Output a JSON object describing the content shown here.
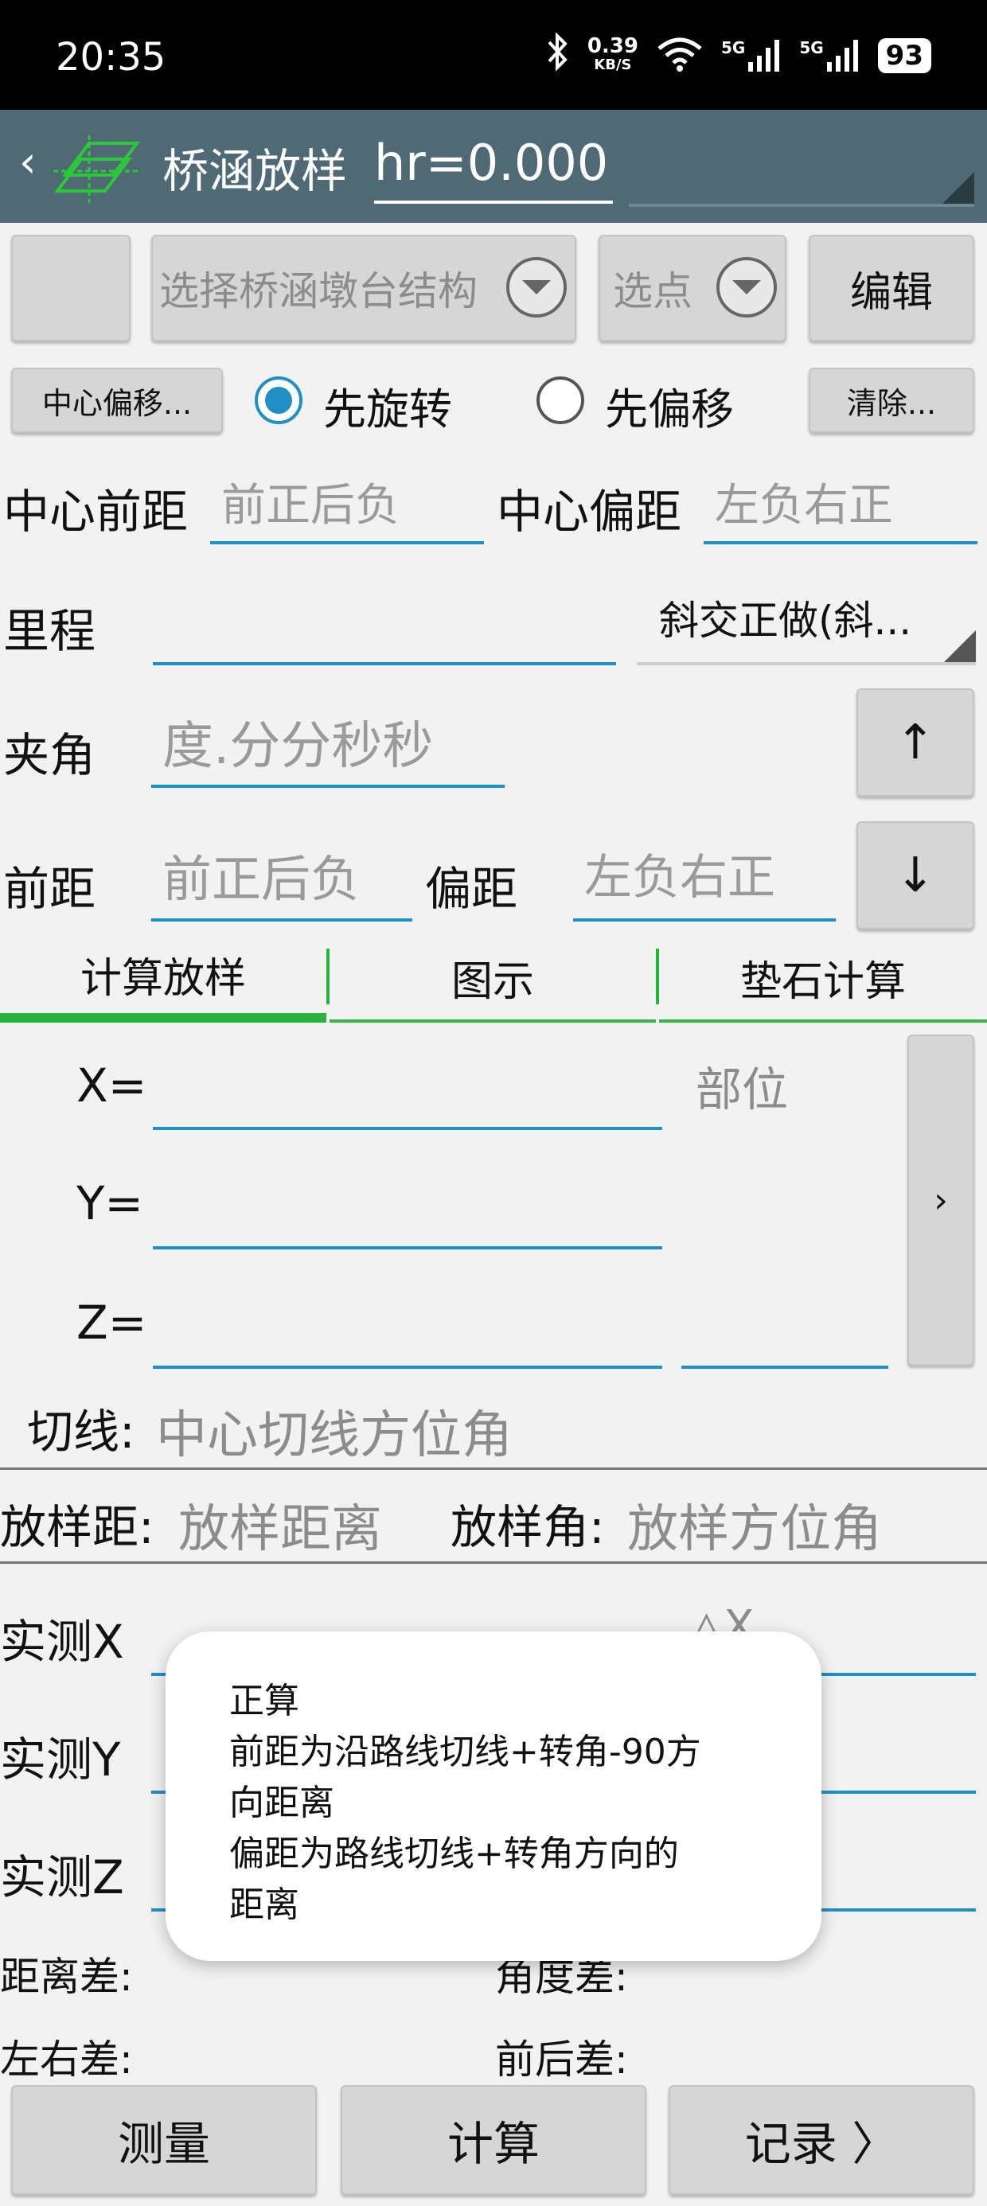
{
  "status": {
    "time": "20:35",
    "speed_value": "0.39",
    "speed_unit": "KB/S",
    "net1": "5G",
    "net2": "5G",
    "battery": "93"
  },
  "titlebar": {
    "title": "桥涵放样",
    "hr_value": "hr=0.000"
  },
  "toolbar": {
    "structure_placeholder": "选择桥涵墩台结构",
    "point_placeholder": "选点",
    "edit_label": "编辑",
    "center_offset_label": "中心偏移...",
    "rotate_first_label": "先旋转",
    "offset_first_label": "先偏移",
    "clear_label": "清除...",
    "rotate_first_selected": true
  },
  "form": {
    "center_front_label": "中心前距",
    "center_front_placeholder": "前正后负",
    "center_offset_label": "中心偏距",
    "center_offset_placeholder": "左负右正",
    "mileage_label": "里程",
    "mode_value": "斜交正做(斜...",
    "angle_label": "夹角",
    "angle_placeholder": "度.分分秒秒",
    "up_arrow": "↑",
    "down_arrow": "↓",
    "front_label": "前距",
    "front_placeholder": "前正后负",
    "offset_label": "偏距",
    "offset_placeholder": "左负右正"
  },
  "tabs": [
    {
      "label": "计算放样",
      "active": true
    },
    {
      "label": "图示",
      "active": false
    },
    {
      "label": "垫石计算",
      "active": false
    }
  ],
  "results": {
    "x_label": "X=",
    "y_label": "Y=",
    "z_label": "Z=",
    "part_placeholder": "部位",
    "side_arrow": "›",
    "tangent_label": "切线:",
    "tangent_placeholder": "中心切线方位角",
    "stake_dist_label": "放样距:",
    "stake_dist_placeholder": "放样距离",
    "stake_angle_label": "放样角:",
    "stake_angle_placeholder": "放样方位角"
  },
  "measured": {
    "x_label": "实测X",
    "y_label": "实测Y",
    "z_label": "实测Z",
    "dx_label": "△X",
    "dist_diff_label": "距离差:",
    "angle_diff_label": "角度差:",
    "lr_diff_label": "左右差:",
    "fb_diff_label": "前后差:"
  },
  "toast": {
    "lines": [
      "正算",
      "前距为沿路线切线+转角-90方",
      "向距离",
      "偏距为路线切线+转角方向的",
      "距离"
    ]
  },
  "bottom": {
    "measure_label": "测量",
    "calc_label": "计算",
    "record_label": "记录 〉"
  },
  "colors": {
    "titlebar": "#4f6a74",
    "accent_blue": "#1f8fc4",
    "tab_green": "#27b33c"
  }
}
